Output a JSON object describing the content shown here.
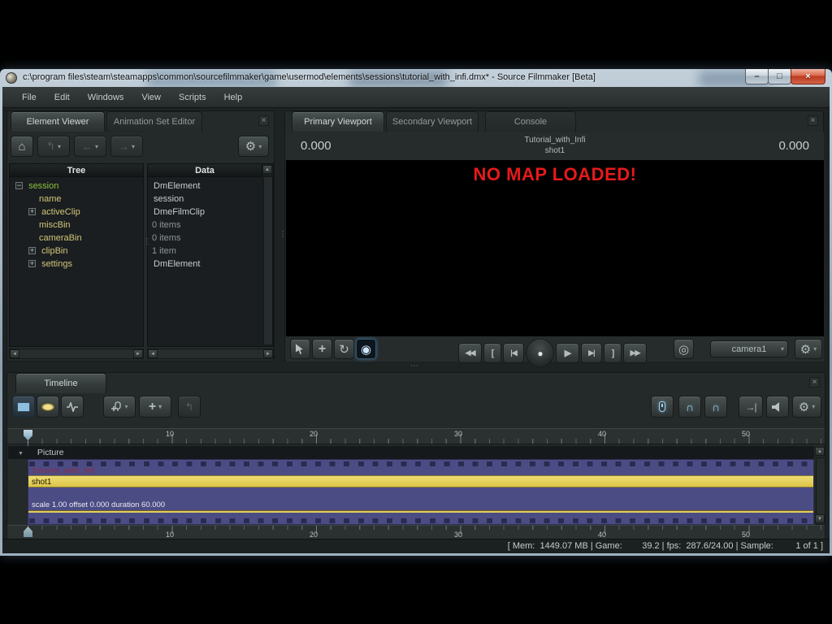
{
  "window": {
    "title": "c:\\program files\\steam\\steamapps\\common\\sourcefilmmaker\\game\\usermod\\elements\\sessions\\tutorial_with_infi.dmx* - Source Filmmaker [Beta]",
    "controls": {
      "minimize": "–",
      "maximize": "□",
      "close": "×"
    }
  },
  "menu": {
    "items": [
      "File",
      "Edit",
      "Windows",
      "View",
      "Scripts",
      "Help"
    ]
  },
  "icons": {
    "home": "⌂",
    "up_nav": "↰",
    "back": "←",
    "forward": "→",
    "gear": "⚙",
    "close": "×",
    "caret": "▾",
    "rotate": "↻",
    "target_active": "◉",
    "camera_target": "◎",
    "rewind": "◀◀",
    "bracket_in": "[",
    "go_start": "|◀",
    "record": "●",
    "play": "▶",
    "go_end": "▶|",
    "bracket_out": "]",
    "fast_forward": "▶▶",
    "skip_to_end": "→|",
    "magnet": "∩",
    "plus": "+",
    "pin_plus": "+",
    "waveform": "∿",
    "scroll_up": "▲",
    "scroll_down": "▼",
    "scroll_left": "◄",
    "scroll_right": "►",
    "collapse": "▼",
    "expand_plus": "+",
    "expand_minus": "−",
    "move": "+"
  },
  "colors": {
    "session_green": "#8bc23a",
    "attr_khaki": "#d2c679",
    "track_purple": "#4c4c85",
    "track_yellow": "#e5ce58",
    "overlay_red": "#e61a1a",
    "icon_blue": "#9fd4f0"
  },
  "element_viewer": {
    "tabs": [
      {
        "label": "Element Viewer"
      },
      {
        "label": "Animation Set Editor"
      }
    ],
    "tree_header": "Tree",
    "data_header": "Data",
    "rows": [
      {
        "label": "session",
        "value": "DmElement"
      },
      {
        "label": "name",
        "value": "session"
      },
      {
        "label": "activeClip",
        "value": "DmeFilmClip"
      },
      {
        "label": "miscBin",
        "value": "0 items"
      },
      {
        "label": "cameraBin",
        "value": "0 items"
      },
      {
        "label": "clipBin",
        "value": "1 item"
      },
      {
        "label": "settings",
        "value": "DmElement"
      }
    ]
  },
  "viewport": {
    "tabs": [
      {
        "label": "Primary Viewport"
      },
      {
        "label": "Secondary Viewport"
      },
      {
        "label": "Console"
      }
    ],
    "time_left": "0.000",
    "time_right": "0.000",
    "session_label": "Tutorial_with_Infi",
    "shot_label": "shot1",
    "overlay": "NO MAP LOADED!",
    "camera_selector": "camera1"
  },
  "timeline": {
    "tab": "Timeline",
    "ruler_ticks": [
      "10",
      "20",
      "30",
      "40",
      "50"
    ],
    "picture_label": "Picture",
    "clip_name": "Tutorial_with_Infi",
    "shot_name": "shot1",
    "scale_text": "scale 1.00 offset 0.000 duration 60.000"
  },
  "status_bar": {
    "text": "[ Mem:  1449.07 MB | Game:        39.2 | fps:  287.6/24.00 | Sample:         1 of 1 ]"
  }
}
